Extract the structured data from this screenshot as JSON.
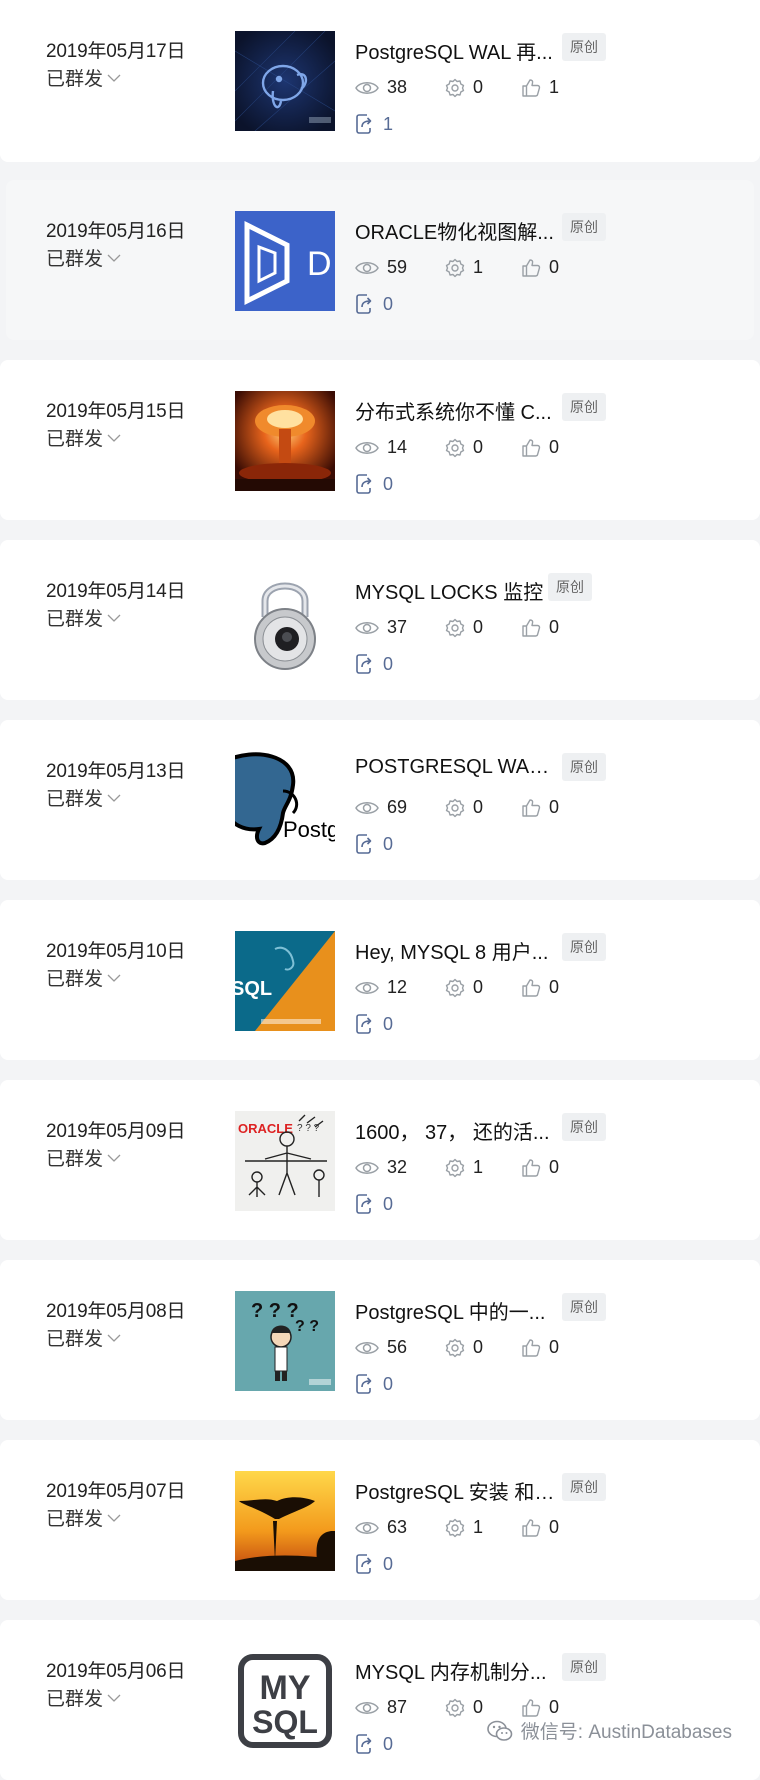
{
  "articles": [
    {
      "date": "2019年05月17日",
      "status": "已群发",
      "title": "PostgreSQL WAL 再...",
      "badge": "原创",
      "reads": "38",
      "shares": "0",
      "likes": "1",
      "forwards": "1",
      "thumb": "pg-elephant-dark"
    },
    {
      "date": "2019年05月16日",
      "status": "已群发",
      "title": "ORACLE物化视图解...",
      "badge": "原创",
      "reads": "59",
      "shares": "1",
      "likes": "0",
      "forwards": "0",
      "thumb": "blue-d-logo"
    },
    {
      "date": "2019年05月15日",
      "status": "已群发",
      "title": "分布式系统你不懂 C...",
      "badge": "原创",
      "reads": "14",
      "shares": "0",
      "likes": "0",
      "forwards": "0",
      "thumb": "mushroom-cloud"
    },
    {
      "date": "2019年05月14日",
      "status": "已群发",
      "title": "MYSQL  LOCKS 监控",
      "badge": "原创",
      "reads": "37",
      "shares": "0",
      "likes": "0",
      "forwards": "0",
      "thumb": "padlock"
    },
    {
      "date": "2019年05月13日",
      "status": "已群发",
      "title": "POSTGRESQL WAL ...",
      "badge": "原创",
      "reads": "69",
      "shares": "0",
      "likes": "0",
      "forwards": "0",
      "thumb": "postgres-logo"
    },
    {
      "date": "2019年05月10日",
      "status": "已群发",
      "title": "Hey, MYSQL 8 用户...",
      "badge": "原创",
      "reads": "12",
      "shares": "0",
      "likes": "0",
      "forwards": "0",
      "thumb": "mysql-dolphin"
    },
    {
      "date": "2019年05月09日",
      "status": "已群发",
      "title": "1600， 37， 还的活...",
      "badge": "原创",
      "reads": "32",
      "shares": "1",
      "likes": "0",
      "forwards": "0",
      "thumb": "oracle-cartoon"
    },
    {
      "date": "2019年05月08日",
      "status": "已群发",
      "title": "PostgreSQL 中的一...",
      "badge": "原创",
      "reads": "56",
      "shares": "0",
      "likes": "0",
      "forwards": "0",
      "thumb": "question-person"
    },
    {
      "date": "2019年05月07日",
      "status": "已群发",
      "title": "PostgreSQL 安装 和 ...",
      "badge": "原创",
      "reads": "63",
      "shares": "1",
      "likes": "0",
      "forwards": "0",
      "thumb": "sunset-tree"
    },
    {
      "date": "2019年05月06日",
      "status": "已群发",
      "title": "MYSQL 内存机制分...",
      "badge": "原创",
      "reads": "87",
      "shares": "0",
      "likes": "0",
      "forwards": "0",
      "thumb": "mysql-logo-box"
    }
  ],
  "thumb_texts": {
    "oracle": "ORACLE",
    "sql": "SQL",
    "my": "MY",
    "sql2": "SQL",
    "postg": "Postg",
    "d": "D"
  },
  "watermark": "微信号: AustinDatabases",
  "colors": {
    "link": "#576b95",
    "badge_bg": "#eef0f2",
    "icon": "#9aa0a6"
  }
}
